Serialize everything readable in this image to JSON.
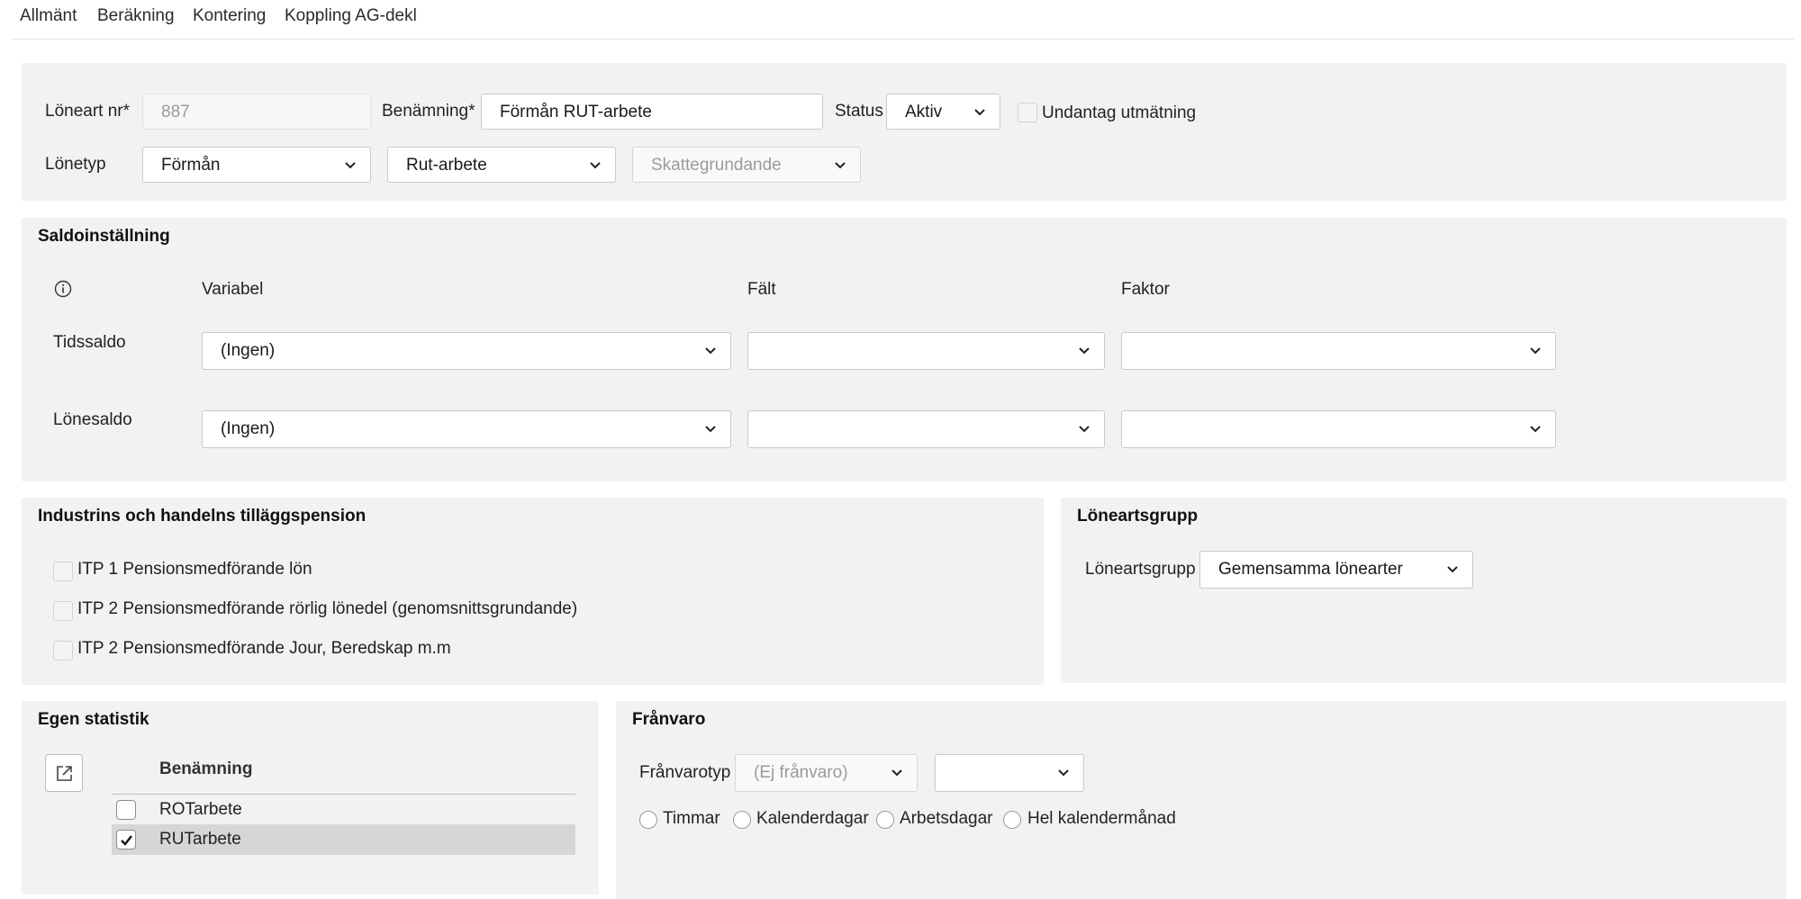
{
  "tabs": [
    "Allmänt",
    "Beräkning",
    "Kontering",
    "Koppling AG-dekl"
  ],
  "general": {
    "loneart_label": "Löneart nr*",
    "loneart_value": "887",
    "benamning_label": "Benämning*",
    "benamning_value": "Förmån RUT-arbete",
    "status_label": "Status",
    "status_value": "Aktiv",
    "undantag_label": "Undantag utmätning",
    "lonetyp_label": "Lönetyp",
    "lonetyp_value": "Förmån",
    "subtype_value": "Rut-arbete",
    "skatt_placeholder": "Skattegrundande"
  },
  "saldo": {
    "title": "Saldoinställning",
    "col_variabel": "Variabel",
    "col_falt": "Fält",
    "col_faktor": "Faktor",
    "rows": [
      {
        "label": "Tidssaldo",
        "variabel": "(Ingen)",
        "falt": "",
        "faktor": ""
      },
      {
        "label": "Lönesaldo",
        "variabel": "(Ingen)",
        "falt": "",
        "faktor": ""
      }
    ]
  },
  "itp": {
    "title": "Industrins och handelns tilläggspension",
    "items": [
      "ITP 1 Pensionsmedförande lön",
      "ITP 2 Pensionsmedförande rörlig lönedel (genomsnittsgrundande)",
      "ITP 2 Pensionsmedförande Jour, Beredskap m.m"
    ]
  },
  "loneartsgrupp": {
    "title": "Löneartsgrupp",
    "label": "Löneartsgrupp",
    "value": "Gemensamma lönearter"
  },
  "statistik": {
    "title": "Egen statistik",
    "col_header": "Benämning",
    "rows": [
      {
        "label": "ROTarbete",
        "checked": false
      },
      {
        "label": "RUTarbete",
        "checked": true
      }
    ]
  },
  "franvaro": {
    "title": "Frånvaro",
    "typ_label": "Frånvarotyp",
    "typ_value": "(Ej frånvaro)",
    "second_value": "",
    "options": [
      "Timmar",
      "Kalenderdagar",
      "Arbetsdagar",
      "Hel kalendermånad"
    ]
  },
  "colors": {
    "panel_bg": "#f2f2f2",
    "selected_row": "#d6d6d6",
    "border": "#c9c9c9"
  }
}
